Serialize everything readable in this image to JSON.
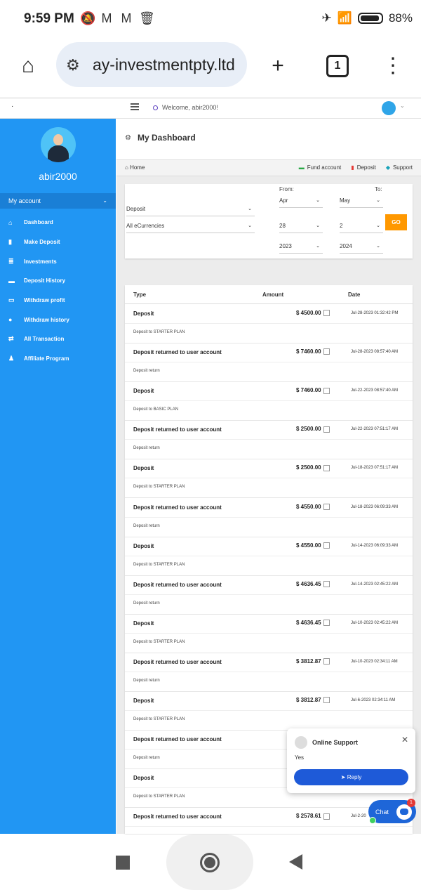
{
  "status_bar": {
    "time": "9:59 PM",
    "icons": [
      "bell-off-icon",
      "gmail-icon",
      "gmail-icon",
      "trash-icon"
    ],
    "battery": "88%"
  },
  "browser": {
    "url": "ay-investmentpty.ltd",
    "tab_count": "1"
  },
  "site_header": {
    "welcome": "Welcome, abir2000!"
  },
  "sidebar": {
    "username": "abir2000",
    "my_account": "My account",
    "items": [
      {
        "label": "Dashboard",
        "icon": "home-icon"
      },
      {
        "label": "Make Deposit",
        "icon": "bar-chart-icon"
      },
      {
        "label": "Investments",
        "icon": "database-icon"
      },
      {
        "label": "Deposit History",
        "icon": "folder-icon"
      },
      {
        "label": "Withdraw profit",
        "icon": "money-icon"
      },
      {
        "label": "Withdraw history",
        "icon": "piggy-bank-icon"
      },
      {
        "label": "All Transaction",
        "icon": "transaction-icon"
      },
      {
        "label": "Affiliate Program",
        "icon": "affiliate-icon"
      }
    ]
  },
  "main": {
    "title": "My Dashboard",
    "breadcrumb_home": "Home",
    "links": {
      "fund": "Fund account",
      "deposit": "Deposit",
      "support": "Support"
    },
    "filter": {
      "type": "Deposit",
      "currency": "All eCurrencies",
      "from_label": "From:",
      "to_label": "To:",
      "from_month": "Apr",
      "from_day": "28",
      "from_year": "2023",
      "to_month": "May",
      "to_day": "2",
      "to_year": "2024",
      "go": "GO"
    },
    "table": {
      "headers": {
        "type": "Type",
        "amount": "Amount",
        "date": "Date"
      },
      "rows": [
        {
          "type": "Deposit",
          "amount": "$ 4500.00",
          "date": "Jul-28-2023 01:32:42 PM",
          "desc": "Deposit to STARTER PLAN"
        },
        {
          "type": "Deposit returned to user account",
          "amount": "$ 7460.00",
          "date": "Jul-28-2023 08:57:40 AM",
          "desc": "Deposit return"
        },
        {
          "type": "Deposit",
          "amount": "$ 7460.00",
          "date": "Jul-22-2023 08:57:40 AM",
          "desc": "Deposit to BASIC PLAN"
        },
        {
          "type": "Deposit returned to user account",
          "amount": "$ 2500.00",
          "date": "Jul-22-2023 07:51:17 AM",
          "desc": "Deposit return"
        },
        {
          "type": "Deposit",
          "amount": "$ 2500.00",
          "date": "Jul-18-2023 07:51:17 AM",
          "desc": "Deposit to STARTER PLAN"
        },
        {
          "type": "Deposit returned to user account",
          "amount": "$ 4550.00",
          "date": "Jul-18-2023 06:09:33 AM",
          "desc": "Deposit return"
        },
        {
          "type": "Deposit",
          "amount": "$ 4550.00",
          "date": "Jul-14-2023 06:09:33 AM",
          "desc": "Deposit to STARTER PLAN"
        },
        {
          "type": "Deposit returned to user account",
          "amount": "$ 4636.45",
          "date": "Jul-14-2023 02:45:22 AM",
          "desc": "Deposit return"
        },
        {
          "type": "Deposit",
          "amount": "$ 4636.45",
          "date": "Jul-10-2023 02:45:22 AM",
          "desc": "Deposit to STARTER PLAN"
        },
        {
          "type": "Deposit returned to user account",
          "amount": "$ 3812.87",
          "date": "Jul-10-2023 02:34:11 AM",
          "desc": "Deposit return"
        },
        {
          "type": "Deposit",
          "amount": "$ 3812.87",
          "date": "Jul-6-2023 02:34:11 AM",
          "desc": "Deposit to STARTER PLAN"
        },
        {
          "type": "Deposit returned to user account",
          "amount": "",
          "date": "",
          "desc": "Deposit return"
        },
        {
          "type": "Deposit",
          "amount": "",
          "date": "",
          "desc": "Deposit to STARTER PLAN"
        },
        {
          "type": "Deposit returned to user account",
          "amount": "$ 2578.61",
          "date": "Jul-2-20",
          "desc": ""
        }
      ]
    }
  },
  "support_popup": {
    "title": "Online Support",
    "message": "Yes",
    "reply": "Reply"
  },
  "chat": {
    "label": "Chat",
    "badge": "1"
  }
}
